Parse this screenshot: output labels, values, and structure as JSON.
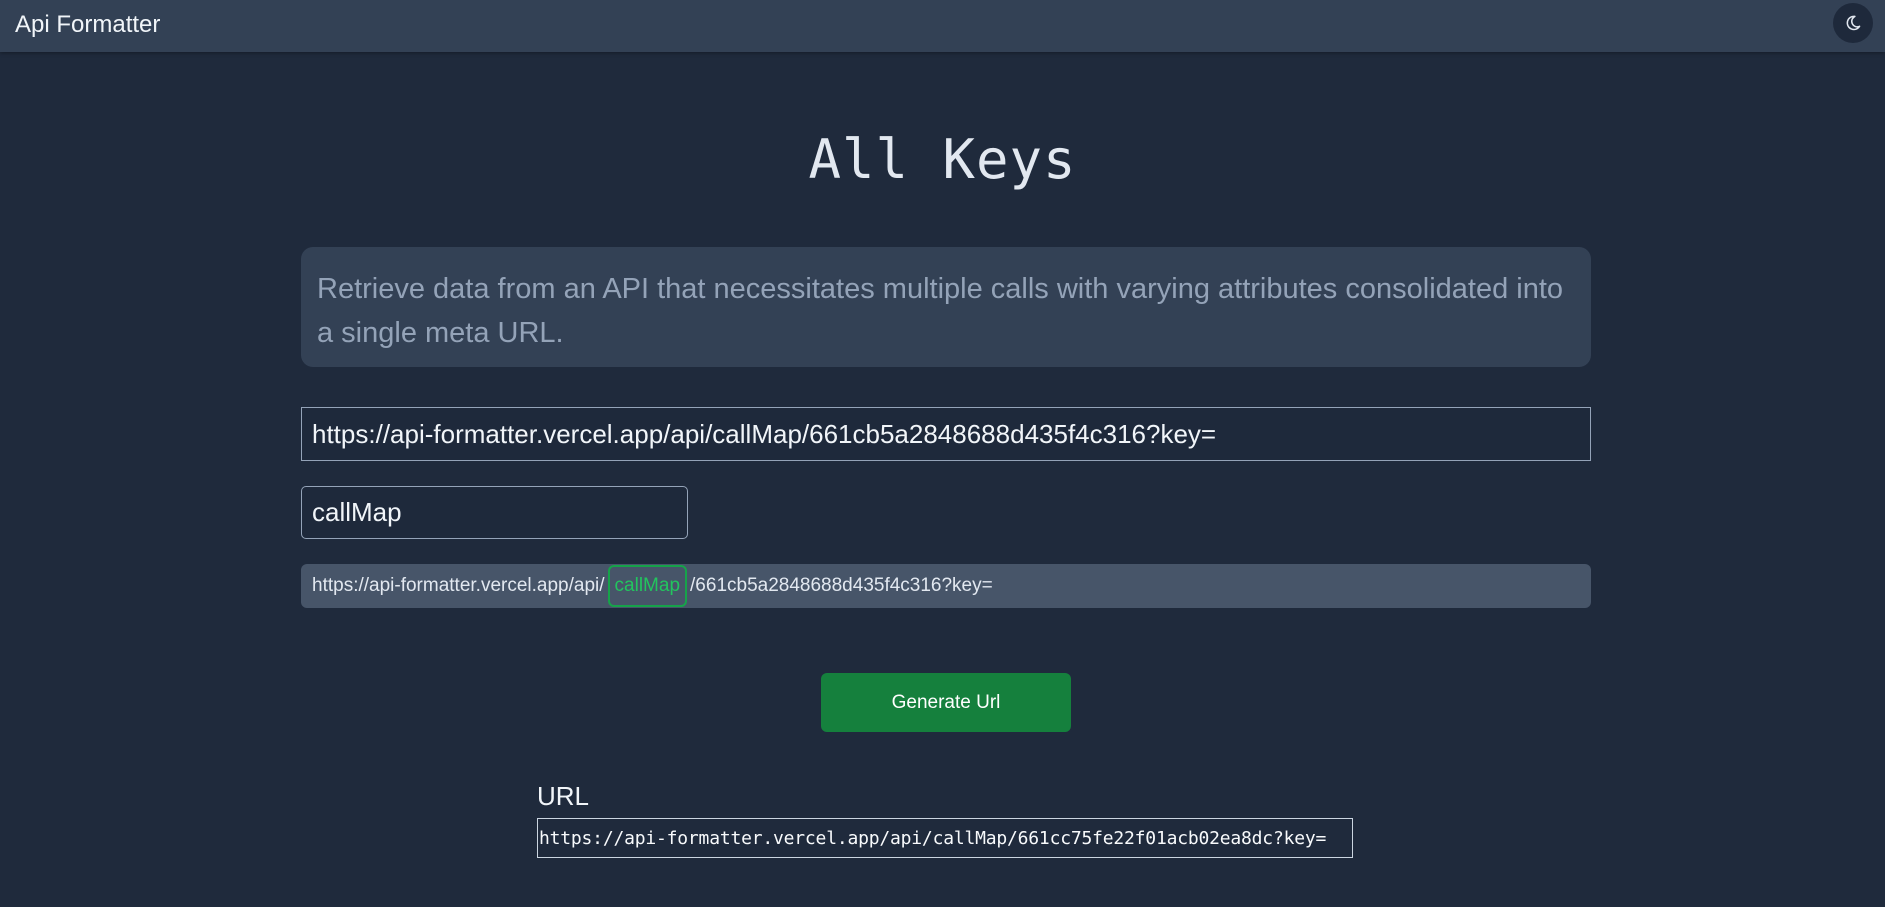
{
  "navbar": {
    "brand": "Api Formatter",
    "theme_toggle_icon": "moon-icon"
  },
  "page": {
    "title": "All Keys",
    "description": "Retrieve data from an API that necessitates multiple calls with varying attributes consolidated into a single meta URL."
  },
  "form": {
    "url_value": "https://api-formatter.vercel.app/api/callMap/661cb5a2848688d435f4c316?key=",
    "key_value": "callMap",
    "preview": {
      "prefix": "https://api-formatter.vercel.app/api/",
      "highlight": "callMap",
      "suffix": "/661cb5a2848688d435f4c316?key="
    },
    "generate_button": "Generate Url"
  },
  "result": {
    "label": "URL",
    "url": "https://api-formatter.vercel.app/api/callMap/661cc75fe22f01acb02ea8dc?key="
  },
  "colors": {
    "background": "#1f2a3c",
    "navbar": "#334155",
    "accent_green": "#15803d",
    "highlight_green": "#22c55e"
  }
}
